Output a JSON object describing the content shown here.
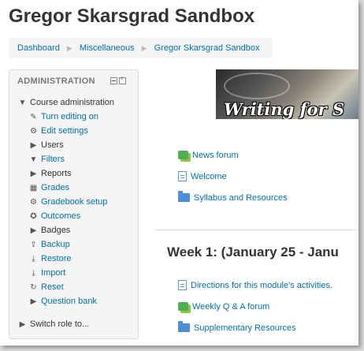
{
  "page": {
    "title": "Gregor Skarsgrad Sandbox"
  },
  "breadcrumb": [
    "Dashboard",
    "Miscellaneous",
    "Gregor Skarsgrad Sandbox"
  ],
  "admin": {
    "header": "ADMINISTRATION",
    "items": [
      {
        "label": "Course administration",
        "icon": "caret-down-icon",
        "style": "plain"
      },
      {
        "label": "Turn editing on",
        "icon": "pencil-icon",
        "style": "link"
      },
      {
        "label": "Edit settings",
        "icon": "gear-icon",
        "style": "link"
      },
      {
        "label": "Users",
        "icon": "caret-right-icon",
        "style": "plain"
      },
      {
        "label": "Filters",
        "icon": "filter-icon",
        "style": "link"
      },
      {
        "label": "Reports",
        "icon": "caret-right-icon",
        "style": "plain"
      },
      {
        "label": "Grades",
        "icon": "table-icon",
        "style": "link"
      },
      {
        "label": "Gradebook setup",
        "icon": "gear-icon",
        "style": "link"
      },
      {
        "label": "Outcomes",
        "icon": "outcomes-icon",
        "style": "link"
      },
      {
        "label": "Badges",
        "icon": "caret-right-icon",
        "style": "plain"
      },
      {
        "label": "Backup",
        "icon": "upload-icon",
        "style": "link"
      },
      {
        "label": "Restore",
        "icon": "download-icon",
        "style": "link"
      },
      {
        "label": "Import",
        "icon": "download-icon",
        "style": "link"
      },
      {
        "label": "Reset",
        "icon": "reset-icon",
        "style": "link"
      },
      {
        "label": "Question bank",
        "icon": "caret-right-icon",
        "style": "link"
      },
      {
        "label": "Switch role to...",
        "icon": "caret-right-icon",
        "style": "plain"
      }
    ]
  },
  "main": {
    "banner_text": "Writing for S",
    "activities_top": [
      {
        "label": "News forum",
        "icon": "forum-icon"
      },
      {
        "label": "Welcome",
        "icon": "page-icon"
      },
      {
        "label": "Syllabus and Resources",
        "icon": "folder-icon"
      }
    ],
    "week1": {
      "heading": "Week 1: (January 25 - Janu",
      "activities": [
        {
          "label": "Directions for this module's activities.",
          "icon": "page-icon"
        },
        {
          "label": "Weekly Q & A forum",
          "icon": "forum-icon"
        },
        {
          "label": "Supplementary Resources",
          "icon": "folder-icon"
        }
      ]
    }
  },
  "colors": {
    "link": "#0070a8",
    "breadcrumb_bg": "#f5f5f5",
    "block_bg": "#f5f5f5"
  }
}
